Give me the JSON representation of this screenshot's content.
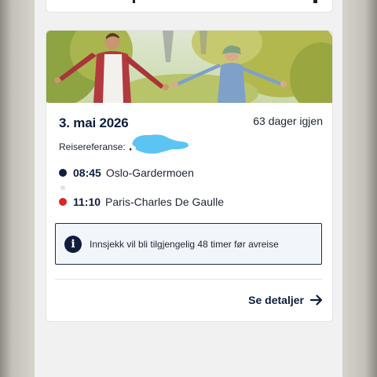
{
  "trip": {
    "date": "3. mai 2026",
    "days_left": "63 dager igjen",
    "ref_label": "Reisereferanse:",
    "departure": {
      "time": "08:45",
      "place": "Oslo-Gardermoen",
      "color": "#0f1e3c"
    },
    "arrival": {
      "time": "11:10",
      "place": "Paris-Charles De Gaulle",
      "color": "#d8262b"
    },
    "checkin_info": "Innsjekk vil bli tilgjengelig 48 timer før avreise",
    "details_label": "Se detaljer"
  },
  "icons": {
    "info": "info-icon",
    "arrow": "arrow-right-icon"
  },
  "colors": {
    "navy": "#0f1e3c",
    "red": "#d8262b",
    "redaction": "#5bc4f3",
    "info_bg": "#f2f6fb"
  }
}
